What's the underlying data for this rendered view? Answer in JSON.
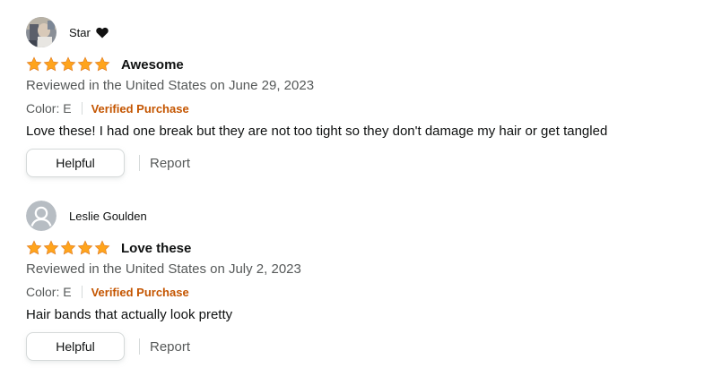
{
  "colors": {
    "star": "#ffa41c",
    "verified": "#c45500",
    "secondary_text": "#565959",
    "primary_text": "#0f1111"
  },
  "reviews": [
    {
      "reviewer": "Star",
      "reviewer_icon": "black-heart-icon",
      "avatar": "photo-avatar",
      "rating": 5,
      "title": "Awesome",
      "date_line": "Reviewed in the United States on June 29, 2023",
      "color_label": "Color: E",
      "verified": "Verified Purchase",
      "body": "Love these! I had one break but they are not too tight so they don't damage my hair or get tangled",
      "helpful_label": "Helpful",
      "report_label": "Report"
    },
    {
      "reviewer": "Leslie Goulden",
      "avatar": "default-user-avatar",
      "rating": 5,
      "title": "Love these",
      "date_line": "Reviewed in the United States on July 2, 2023",
      "color_label": "Color: E",
      "verified": "Verified Purchase",
      "body": "Hair bands that actually look pretty",
      "helpful_label": "Helpful",
      "report_label": "Report"
    }
  ]
}
